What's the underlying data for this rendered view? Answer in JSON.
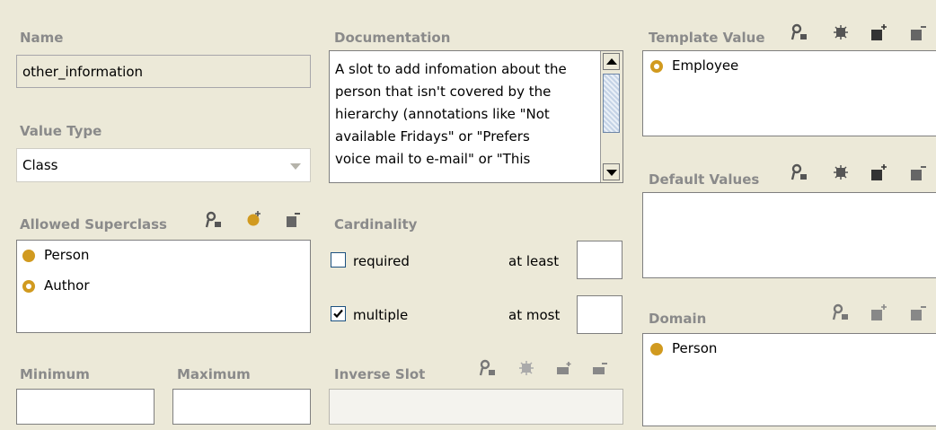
{
  "name": {
    "label": "Name",
    "value": "other_information"
  },
  "value_type": {
    "label": "Value Type",
    "selected": "Class"
  },
  "allowed_superclasses": {
    "label": "Allowed Superclass",
    "items": [
      "Person",
      "Author"
    ]
  },
  "minimum": {
    "label": "Minimum",
    "value": ""
  },
  "maximum": {
    "label": "Maximum",
    "value": ""
  },
  "documentation": {
    "label": "Documentation",
    "lines": [
      "A slot to add infomation about the",
      "person that isn't covered by the",
      "hierarchy (annotations like \"Not",
      "available Fridays\" or \"Prefers",
      "voice mail to e-mail\" or \"This"
    ]
  },
  "cardinality": {
    "label": "Cardinality",
    "required_label": "required",
    "required_checked": false,
    "multiple_label": "multiple",
    "multiple_checked": true,
    "at_least_label": "at least",
    "at_least_value": "",
    "at_most_label": "at most",
    "at_most_value": ""
  },
  "inverse_slot": {
    "label": "Inverse Slot",
    "value": ""
  },
  "template_value": {
    "label": "Template Value",
    "items": [
      "Employee"
    ]
  },
  "default_values": {
    "label": "Default Values",
    "items": []
  },
  "domain": {
    "label": "Domain",
    "items": [
      "Person"
    ]
  },
  "colors": {
    "background": "#ece9d8",
    "label_gray": "#8a8a8a",
    "class_dot": "#d19a1f"
  }
}
